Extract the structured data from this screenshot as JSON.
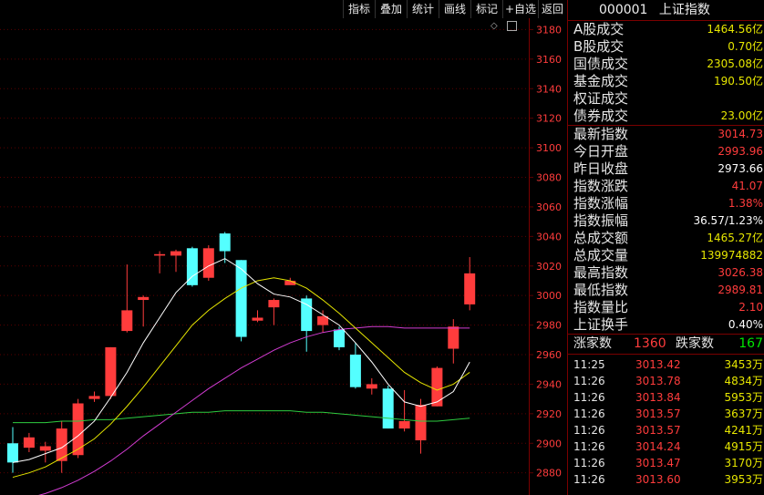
{
  "toolbar": [
    "指标",
    "叠加",
    "统计",
    "画线",
    "标记",
    "+自选",
    "返回"
  ],
  "chart_data": {
    "type": "candlestick",
    "ylim": [
      2865,
      3200
    ],
    "y_ticks": [
      2880,
      2900,
      2920,
      2940,
      2960,
      2980,
      3000,
      3020,
      3040,
      3060,
      3080,
      3100,
      3120,
      3140,
      3160,
      3180
    ],
    "candles": [
      {
        "o": 2900,
        "c": 2887,
        "h": 2911,
        "l": 2880
      },
      {
        "o": 2897,
        "c": 2904,
        "h": 2907,
        "l": 2894
      },
      {
        "o": 2895,
        "c": 2898,
        "h": 2901,
        "l": 2887
      },
      {
        "o": 2888,
        "c": 2910,
        "h": 2915,
        "l": 2880
      },
      {
        "o": 2892,
        "c": 2927,
        "h": 2930,
        "l": 2890
      },
      {
        "o": 2930,
        "c": 2932,
        "h": 2935,
        "l": 2928
      },
      {
        "o": 2932,
        "c": 2965,
        "h": 2965,
        "l": 2930
      },
      {
        "o": 2976,
        "c": 2990,
        "h": 3021,
        "l": 2975
      },
      {
        "o": 2997,
        "c": 2999,
        "h": 3000,
        "l": 2979
      },
      {
        "o": 3027,
        "c": 3028,
        "h": 3030,
        "l": 3015
      },
      {
        "o": 3027,
        "c": 3030,
        "h": 3031,
        "l": 3016
      },
      {
        "o": 3032,
        "c": 3007,
        "h": 3033,
        "l": 3006
      },
      {
        "o": 3012,
        "c": 3032,
        "h": 3034,
        "l": 3010
      },
      {
        "o": 3042,
        "c": 3030,
        "h": 3043,
        "l": 3022
      },
      {
        "o": 3024,
        "c": 2972,
        "h": 3024,
        "l": 2969
      },
      {
        "o": 2983,
        "c": 2985,
        "h": 2990,
        "l": 2982
      },
      {
        "o": 2992,
        "c": 2997,
        "h": 2998,
        "l": 2980
      },
      {
        "o": 3007,
        "c": 3010,
        "h": 3012,
        "l": 3008
      },
      {
        "o": 2998,
        "c": 2976,
        "h": 3000,
        "l": 2962
      },
      {
        "o": 2980,
        "c": 2986,
        "h": 2990,
        "l": 2975
      },
      {
        "o": 2977,
        "c": 2965,
        "h": 2979,
        "l": 2963
      },
      {
        "o": 2960,
        "c": 2938,
        "h": 2968,
        "l": 2937
      },
      {
        "o": 2937,
        "c": 2940,
        "h": 2944,
        "l": 2933
      },
      {
        "o": 2937,
        "c": 2910,
        "h": 2939,
        "l": 2910
      },
      {
        "o": 2910,
        "c": 2915,
        "h": 2936,
        "l": 2908
      },
      {
        "o": 2902,
        "c": 2926,
        "h": 2930,
        "l": 2893
      },
      {
        "o": 2925,
        "c": 2951,
        "h": 2952,
        "l": 2925
      },
      {
        "o": 2964,
        "c": 2979,
        "h": 2984,
        "l": 2954
      },
      {
        "o": 2994,
        "c": 3015,
        "h": 3026,
        "l": 2990
      }
    ],
    "ma_white": [
      2887,
      2889,
      2893,
      2897,
      2905,
      2915,
      2931,
      2948,
      2968,
      2985,
      3002,
      3013,
      3020,
      3025,
      3018,
      3008,
      3001,
      2999,
      2994,
      2987,
      2980,
      2968,
      2955,
      2940,
      2928,
      2925,
      2928,
      2935,
      2955
    ],
    "ma_yellow": [
      2877,
      2880,
      2884,
      2890,
      2896,
      2903,
      2913,
      2925,
      2938,
      2952,
      2966,
      2980,
      2990,
      2998,
      3005,
      3010,
      3012,
      3010,
      3005,
      2997,
      2988,
      2978,
      2968,
      2958,
      2948,
      2941,
      2936,
      2940,
      2948
    ],
    "ma_purple": [
      2860,
      2863,
      2866,
      2870,
      2875,
      2881,
      2888,
      2896,
      2905,
      2913,
      2921,
      2929,
      2937,
      2944,
      2951,
      2957,
      2963,
      2968,
      2972,
      2975,
      2977,
      2978,
      2979,
      2979,
      2978,
      2978,
      2978,
      2978,
      2978
    ],
    "ma_green": [
      2914,
      2914,
      2914,
      2915,
      2915,
      2916,
      2916,
      2917,
      2918,
      2919,
      2920,
      2921,
      2921,
      2922,
      2922,
      2922,
      2922,
      2922,
      2921,
      2921,
      2920,
      2919,
      2918,
      2917,
      2916,
      2915,
      2915,
      2916,
      2917
    ],
    "colors": {
      "up": "#ff3c3c",
      "down": "#54ffff",
      "ma_white": "#ffffff",
      "ma_yellow": "#e6e600",
      "ma_purple": "#d23cd2",
      "ma_green": "#2ecc40",
      "grid": "#5a0000",
      "axis_text": "#ff3c3c"
    }
  },
  "panel": {
    "code": "000001",
    "name": "上证指数",
    "rows": [
      {
        "label": "A股成交",
        "value": "1464.56亿",
        "color": "y"
      },
      {
        "label": "B股成交",
        "value": "0.70亿",
        "color": "y"
      },
      {
        "label": "国债成交",
        "value": "2305.08亿",
        "color": "y"
      },
      {
        "label": "基金成交",
        "value": "190.50亿",
        "color": "y"
      },
      {
        "label": "权证成交",
        "value": "",
        "color": "y"
      },
      {
        "label": "债券成交",
        "value": "23.00亿",
        "color": "y"
      },
      {
        "label": "最新指数",
        "value": "3014.73",
        "color": "r"
      },
      {
        "label": "今日开盘",
        "value": "2993.96",
        "color": "r"
      },
      {
        "label": "昨日收盘",
        "value": "2973.66",
        "color": "w"
      },
      {
        "label": "指数涨跌",
        "value": "41.07",
        "color": "r"
      },
      {
        "label": "指数涨幅",
        "value": "1.38%",
        "color": "r"
      },
      {
        "label": "指数振幅",
        "value": "36.57/1.23%",
        "color": "w"
      },
      {
        "label": "总成交额",
        "value": "1465.27亿",
        "color": "y"
      },
      {
        "label": "总成交量",
        "value": "139974882",
        "color": "y"
      },
      {
        "label": "最高指数",
        "value": "3026.38",
        "color": "r"
      },
      {
        "label": "最低指数",
        "value": "2989.81",
        "color": "r"
      },
      {
        "label": "指数量比",
        "value": "2.10",
        "color": "r"
      },
      {
        "label": "上证换手",
        "value": "0.40%",
        "color": "w"
      }
    ],
    "up_label": "涨家数",
    "up_count": "1360",
    "down_label": "跌家数",
    "down_count": "167",
    "trades": [
      {
        "time": "11:25",
        "price": "3013.42",
        "vol": "3453万"
      },
      {
        "time": "11:26",
        "price": "3013.78",
        "vol": "4834万"
      },
      {
        "time": "11:26",
        "price": "3013.84",
        "vol": "5953万"
      },
      {
        "time": "11:26",
        "price": "3013.57",
        "vol": "3637万"
      },
      {
        "time": "11:26",
        "price": "3013.57",
        "vol": "4241万"
      },
      {
        "time": "11:26",
        "price": "3014.24",
        "vol": "4915万"
      },
      {
        "time": "11:26",
        "price": "3013.47",
        "vol": "3170万"
      },
      {
        "time": "11:26",
        "price": "3013.60",
        "vol": "3953万"
      }
    ]
  }
}
